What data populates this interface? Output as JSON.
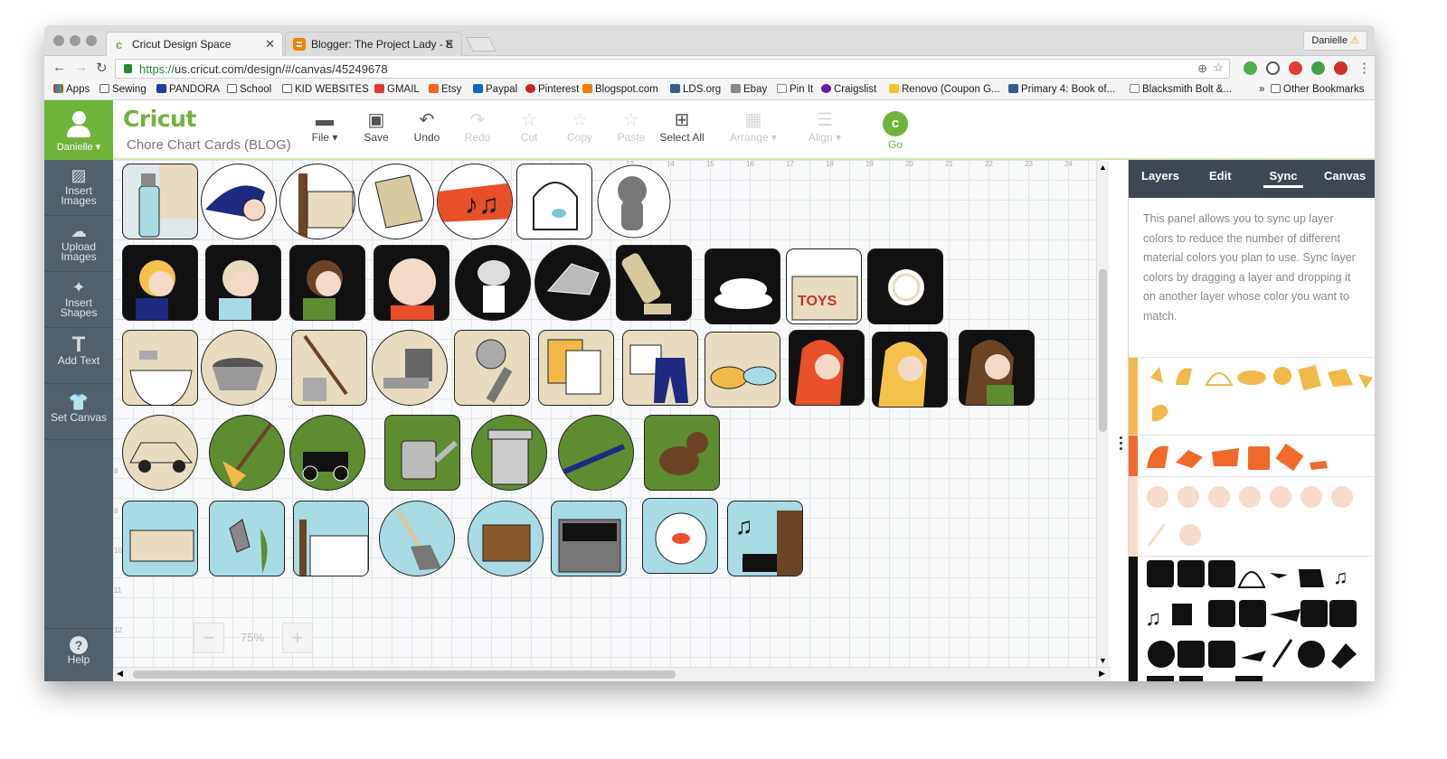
{
  "browser": {
    "tabs": [
      {
        "title": "Cricut Design Space",
        "active": true
      },
      {
        "title": "Blogger: The Project Lady - E",
        "active": false
      }
    ],
    "profile": "Danielle",
    "url_scheme": "https://",
    "url_rest": "us.cricut.com/design/#/canvas/45249678",
    "bookmarks": [
      "Apps",
      "Sewing",
      "PANDORA",
      "School",
      "KID WEBSITES",
      "GMAIL",
      "Etsy",
      "Paypal",
      "Pinterest",
      "Blogspot.com",
      "LDS.org",
      "Ebay",
      "Pin It",
      "Craigslist",
      "Renovo (Coupon G...",
      "Primary 4: Book of...",
      "Blacksmith Bolt &...",
      "Other Bookmarks"
    ],
    "overflow": "»"
  },
  "app": {
    "user": "Danielle",
    "logo": "Cricut",
    "project_name": "Chore Chart Cards (BLOG)",
    "toolbar": {
      "file": "File",
      "save": "Save",
      "undo": "Undo",
      "redo": "Redo",
      "cut": "Cut",
      "copy": "Copy",
      "paste": "Paste",
      "select_all": "Select All",
      "arrange": "Arrange",
      "align": "Align",
      "go": "Go"
    },
    "sidebar": {
      "insert_images": "Insert Images",
      "upload_images": "Upload Images",
      "insert_shapes": "Insert Shapes",
      "add_text": "Add Text",
      "set_canvas": "Set Canvas",
      "help": "Help"
    },
    "zoom": {
      "minus": "−",
      "level": "75%",
      "plus": "+"
    },
    "ruler_top": [
      "13",
      "14",
      "15",
      "16",
      "17",
      "18",
      "19",
      "20",
      "21",
      "22",
      "23",
      "24"
    ],
    "ruler_left": [
      "8",
      "9",
      "10",
      "11",
      "12"
    ]
  },
  "panel": {
    "tabs": [
      "Layers",
      "Edit",
      "Sync",
      "Canvas"
    ],
    "active_tab": "Sync",
    "description": "This panel allows you to sync up layer colors to reduce the number of different material colors you plan to use. Sync layer colors by dragging a layer and dropping it on another layer whose color you want to match.",
    "swatch_colors": [
      "#f0b94a",
      "#f06a2a",
      "#f8dccb",
      "#111111"
    ]
  },
  "colors": {
    "accent": "#6fb33b",
    "sidebar": "#52606b",
    "panel_header": "#3d4852"
  }
}
